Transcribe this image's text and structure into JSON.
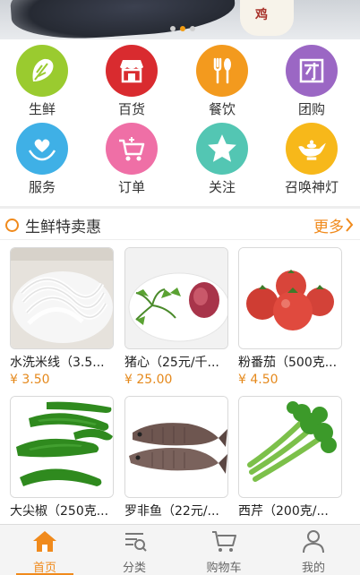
{
  "banner": {
    "overlay_text": "鸡",
    "dots": 3,
    "active_dot": 1
  },
  "categories": [
    {
      "label": "生鲜",
      "color": "#9acb2f",
      "icon": "vegetable-icon"
    },
    {
      "label": "百货",
      "color": "#d92b2f",
      "icon": "store-icon"
    },
    {
      "label": "餐饮",
      "color": "#f39a1e",
      "icon": "utensils-icon"
    },
    {
      "label": "团购",
      "color": "#9b67c4",
      "icon": "group-buy-icon"
    },
    {
      "label": "服务",
      "color": "#3fb0e6",
      "icon": "heart-hands-icon"
    },
    {
      "label": "订单",
      "color": "#ef6fa6",
      "icon": "cart-order-icon"
    },
    {
      "label": "关注",
      "color": "#53c6b3",
      "icon": "star-icon"
    },
    {
      "label": "召唤神灯",
      "color": "#f7b81a",
      "icon": "magic-lamp-icon"
    }
  ],
  "section": {
    "title": "生鲜特卖惠",
    "more": "更多"
  },
  "products": [
    {
      "name": "水洗米线（3.5...",
      "price": "¥ 3.50",
      "image": "rice-noodles"
    },
    {
      "name": "猪心（25元/千...",
      "price": "¥ 25.00",
      "image": "pig-heart"
    },
    {
      "name": "粉番茄（500克...",
      "price": "¥ 4.50",
      "image": "tomatoes"
    },
    {
      "name": "大尖椒（250克...",
      "price": "",
      "image": "green-peppers"
    },
    {
      "name": "罗非鱼（22元/...",
      "price": "",
      "image": "tilapia"
    },
    {
      "name": "西芹（200克/...",
      "price": "",
      "image": "celery"
    }
  ],
  "tabs": [
    {
      "label": "首页",
      "icon": "home-icon",
      "active": true
    },
    {
      "label": "分类",
      "icon": "category-icon",
      "active": false
    },
    {
      "label": "购物车",
      "icon": "shopping-cart-icon",
      "active": false
    },
    {
      "label": "我的",
      "icon": "user-icon",
      "active": false
    }
  ],
  "colors": {
    "accent": "#f08a1c"
  }
}
